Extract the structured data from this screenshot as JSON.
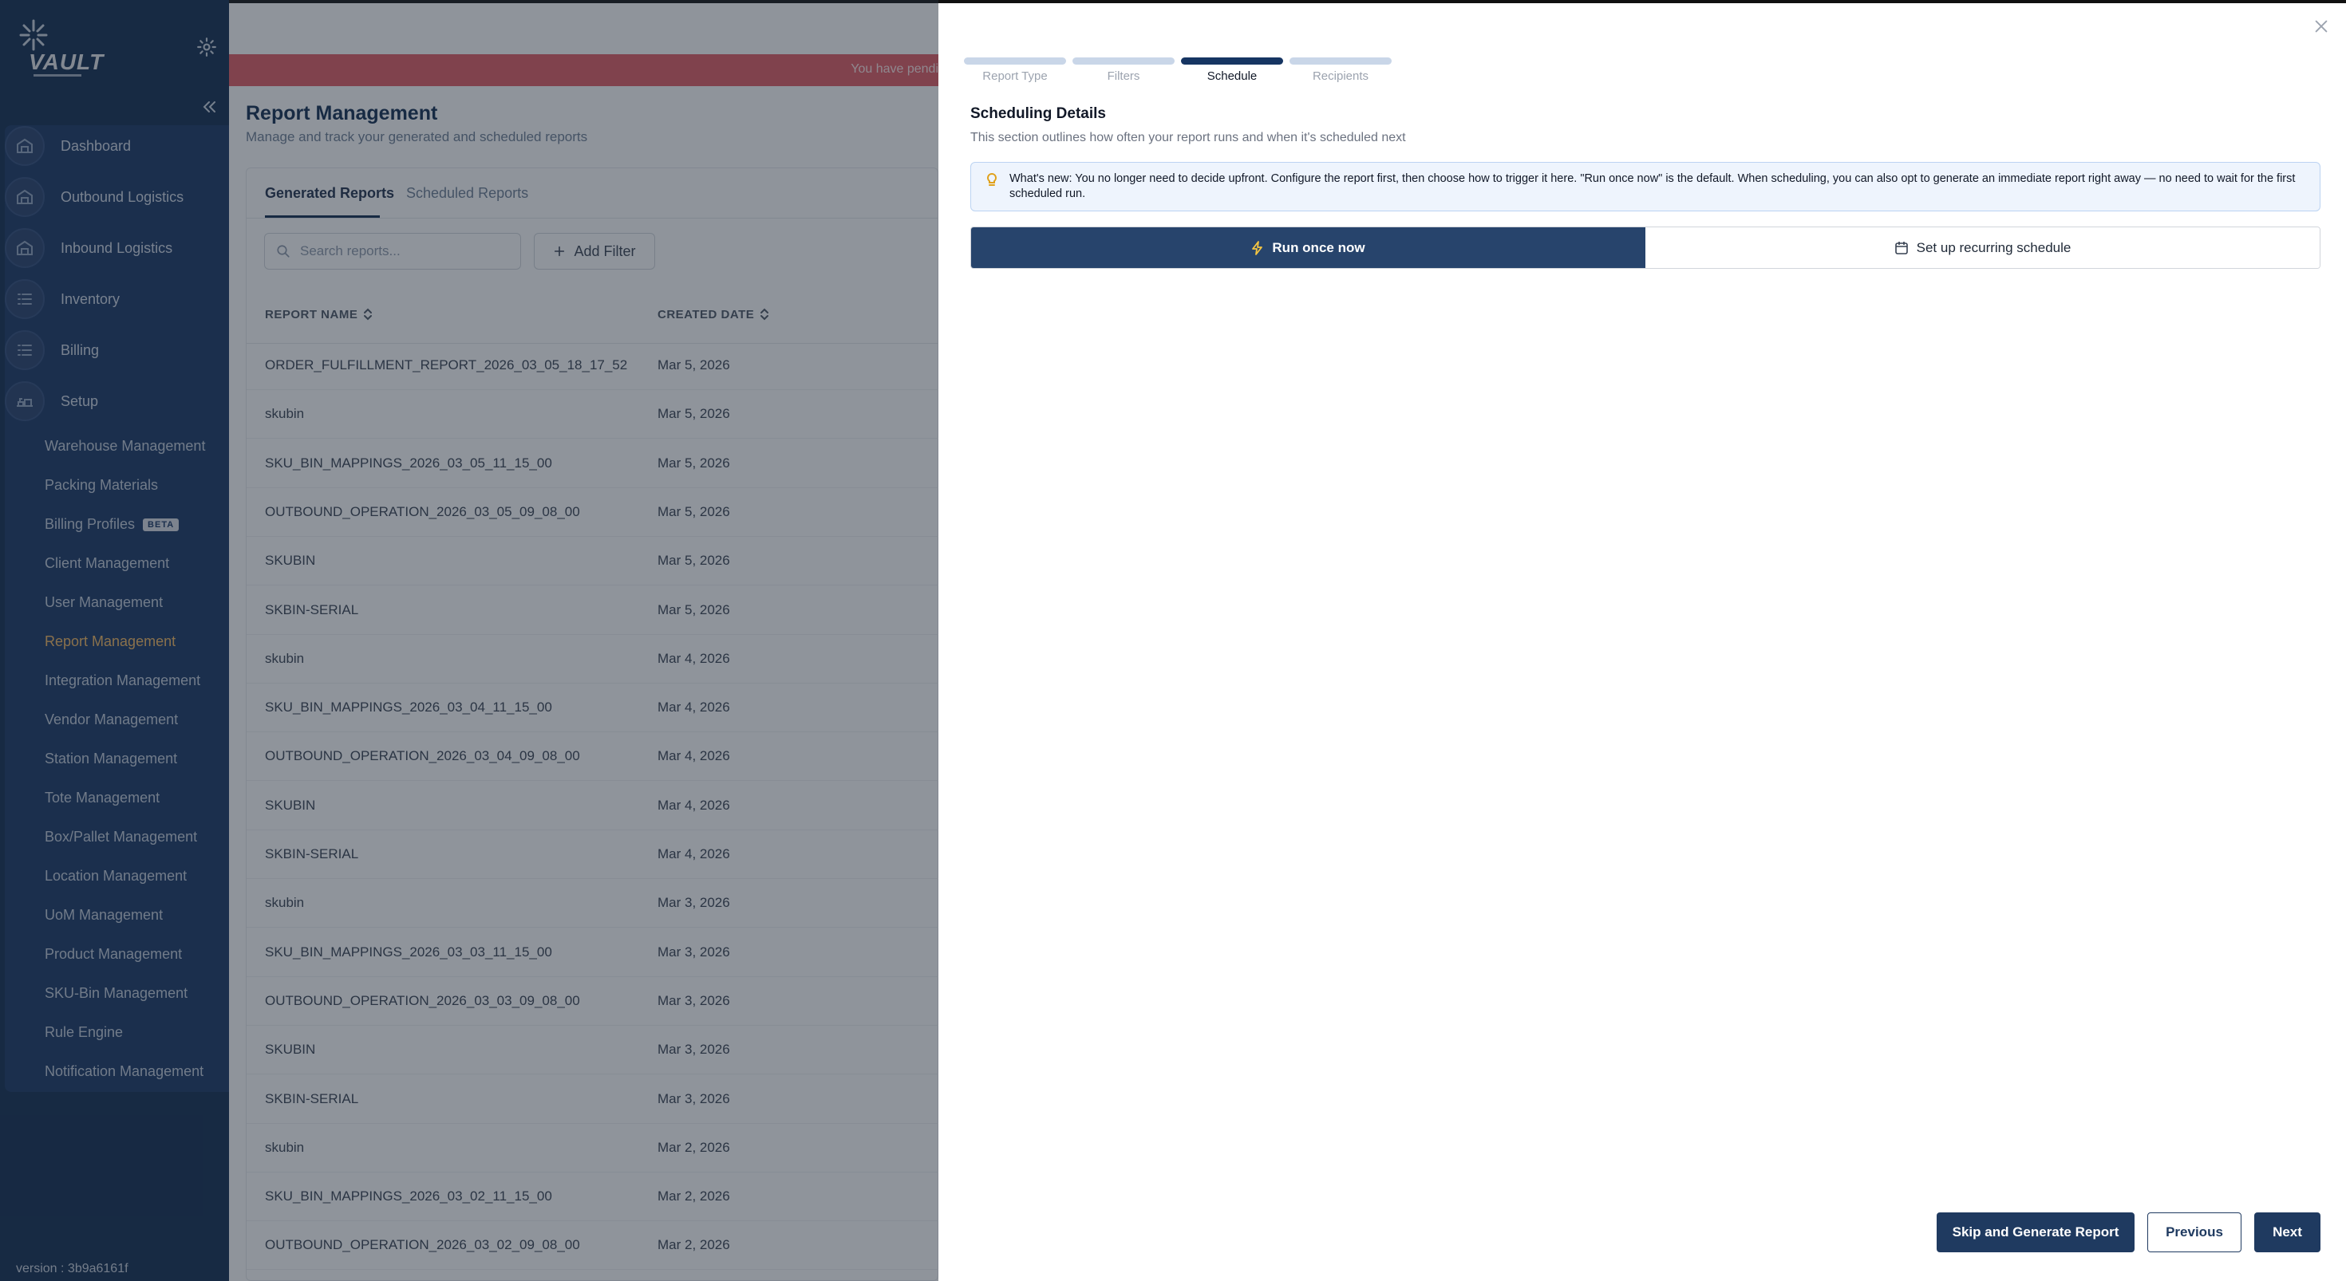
{
  "app": {
    "logo_text": "VAULT",
    "version": "version : 3b9a6161f"
  },
  "sidebar": {
    "nav": [
      {
        "label": "Dashboard",
        "icon": "warehouse-icon"
      },
      {
        "label": "Outbound Logistics",
        "icon": "warehouse-icon"
      },
      {
        "label": "Inbound Logistics",
        "icon": "warehouse-icon"
      },
      {
        "label": "Inventory",
        "icon": "list-icon"
      },
      {
        "label": "Billing",
        "icon": "list-icon"
      },
      {
        "label": "Setup",
        "icon": "setup-icon"
      }
    ],
    "setup_items": [
      "Warehouse Management",
      "Packing Materials",
      "Billing Profiles",
      "Client Management",
      "User Management",
      "Report Management",
      "Integration Management",
      "Vendor Management",
      "Station Management",
      "Tote Management",
      "Box/Pallet Management",
      "Location Management",
      "UoM Management",
      "Product Management",
      "SKU-Bin Management",
      "Rule Engine",
      "Notification Management"
    ],
    "beta_badge": "BETA",
    "active_item": "Report Management"
  },
  "main": {
    "alert": "You have pendi",
    "title": "Report Management",
    "subtitle": "Manage and track your generated and scheduled reports",
    "tabs": [
      "Generated Reports",
      "Scheduled Reports"
    ],
    "search_placeholder": "Search reports...",
    "add_filter": "Add Filter",
    "columns": [
      "REPORT NAME",
      "CREATED DATE"
    ],
    "rows": [
      [
        "ORDER_FULFILLMENT_REPORT_2026_03_05_18_17_52",
        "Mar 5, 2026"
      ],
      [
        "skubin",
        "Mar 5, 2026"
      ],
      [
        "SKU_BIN_MAPPINGS_2026_03_05_11_15_00",
        "Mar 5, 2026"
      ],
      [
        "OUTBOUND_OPERATION_2026_03_05_09_08_00",
        "Mar 5, 2026"
      ],
      [
        "SKUBIN",
        "Mar 5, 2026"
      ],
      [
        "SKBIN-SERIAL",
        "Mar 5, 2026"
      ],
      [
        "skubin",
        "Mar 4, 2026"
      ],
      [
        "SKU_BIN_MAPPINGS_2026_03_04_11_15_00",
        "Mar 4, 2026"
      ],
      [
        "OUTBOUND_OPERATION_2026_03_04_09_08_00",
        "Mar 4, 2026"
      ],
      [
        "SKUBIN",
        "Mar 4, 2026"
      ],
      [
        "SKBIN-SERIAL",
        "Mar 4, 2026"
      ],
      [
        "skubin",
        "Mar 3, 2026"
      ],
      [
        "SKU_BIN_MAPPINGS_2026_03_03_11_15_00",
        "Mar 3, 2026"
      ],
      [
        "OUTBOUND_OPERATION_2026_03_03_09_08_00",
        "Mar 3, 2026"
      ],
      [
        "SKUBIN",
        "Mar 3, 2026"
      ],
      [
        "SKBIN-SERIAL",
        "Mar 3, 2026"
      ],
      [
        "skubin",
        "Mar 2, 2026"
      ],
      [
        "SKU_BIN_MAPPINGS_2026_03_02_11_15_00",
        "Mar 2, 2026"
      ],
      [
        "OUTBOUND_OPERATION_2026_03_02_09_08_00",
        "Mar 2, 2026"
      ]
    ]
  },
  "drawer": {
    "steps": [
      {
        "label": "Report Type",
        "active": false
      },
      {
        "label": "Filters",
        "active": false
      },
      {
        "label": "Schedule",
        "active": true
      },
      {
        "label": "Recipients",
        "active": false
      }
    ],
    "section_title": "Scheduling Details",
    "section_subtitle": "This section outlines how often your report runs and when it's scheduled next",
    "info": "What's new: You no longer need to decide upfront. Configure the report first, then choose how to trigger it here. \"Run once now\" is the default. When scheduling, you can also opt to generate an immediate report right away — no need to wait for the first scheduled run.",
    "run_once": "Run once now",
    "recurring": "Set up recurring schedule",
    "buttons": {
      "skip": "Skip and Generate Report",
      "previous": "Previous",
      "next": "Next"
    }
  },
  "colors": {
    "sidebar": "#0f2a4f",
    "primary": "#1f3a60",
    "active_nav": "#f4b860",
    "alert": "#e05b62",
    "info_bg": "#eef4fd"
  }
}
